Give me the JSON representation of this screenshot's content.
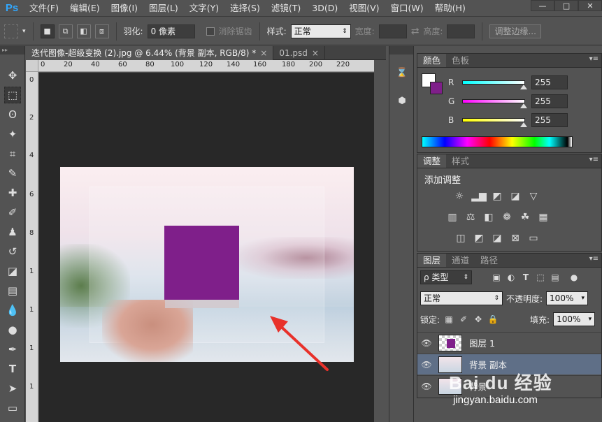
{
  "app": {
    "logo": "Ps"
  },
  "menu": [
    "文件(F)",
    "编辑(E)",
    "图像(I)",
    "图层(L)",
    "文字(Y)",
    "选择(S)",
    "滤镜(T)",
    "3D(D)",
    "视图(V)",
    "窗口(W)",
    "帮助(H)"
  ],
  "window_controls": {
    "minimize": "—",
    "restore": "□",
    "close": "✕"
  },
  "options": {
    "feather_label": "羽化:",
    "feather_value": "0 像素",
    "antialias_label": "消除锯齿",
    "style_label": "样式:",
    "style_value": "正常",
    "width_label": "宽度:",
    "height_label": "高度:",
    "refine_edge": "调整边缘..."
  },
  "tabs": [
    {
      "label": "迭代图像-超级变换 (2).jpg @ 6.44% (背景 副本, RGB/8) *",
      "close": "×"
    },
    {
      "label": "01.psd",
      "close": "×"
    }
  ],
  "ruler_h_labels": [
    "0",
    "20",
    "40",
    "60",
    "80",
    "100",
    "120",
    "140",
    "160",
    "180",
    "200",
    "220"
  ],
  "ruler_v_labels": [
    "0",
    "2",
    "4",
    "6",
    "8",
    "1",
    "1",
    "1",
    "1"
  ],
  "color_panel": {
    "tabs": [
      "颜色",
      "色板"
    ],
    "r_label": "R",
    "g_label": "G",
    "b_label": "B",
    "r_value": "255",
    "g_value": "255",
    "b_value": "255",
    "foreground": "#ffffff",
    "background": "#7f1f8a"
  },
  "adjust_panel": {
    "tabs": [
      "调整",
      "样式"
    ],
    "title": "添加调整"
  },
  "layers_panel": {
    "tabs": [
      "图层",
      "通道",
      "路径"
    ],
    "filter_label": "ρ 类型",
    "blend_mode": "正常",
    "opacity_label": "不透明度:",
    "opacity_value": "100%",
    "lock_label": "锁定:",
    "fill_label": "填充:",
    "fill_value": "100%",
    "layers": [
      {
        "name": "图层 1",
        "visible": "👁"
      },
      {
        "name": "背景 副本",
        "visible": "👁"
      },
      {
        "name": "背景",
        "visible": "👁"
      }
    ]
  },
  "watermark": {
    "brand": "Bai du 经验",
    "url": "jingyan.baidu.com"
  },
  "colors": {
    "accent_purple": "#7f1f8a",
    "ps_blue": "#31a8ff",
    "selected_layer": "#5f6f87"
  }
}
